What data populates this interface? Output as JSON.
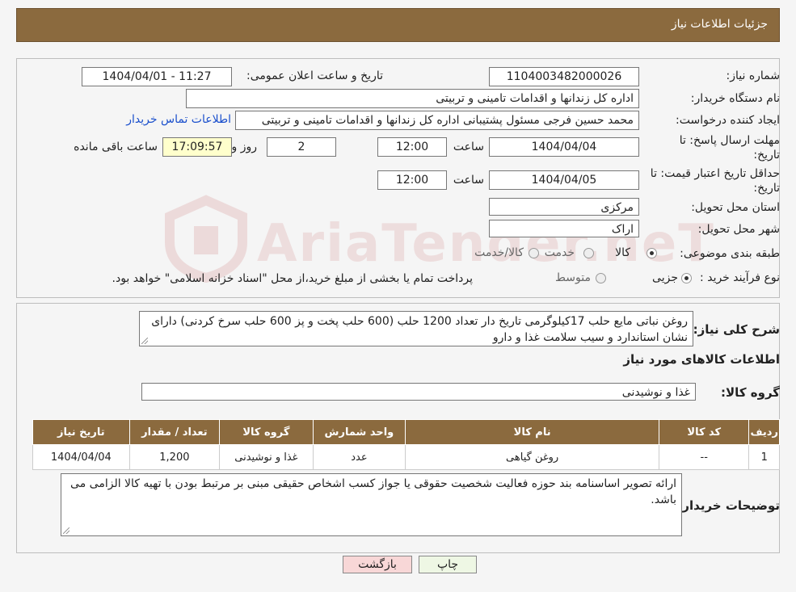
{
  "header": {
    "title": "جزئیات اطلاعات نیاز"
  },
  "form": {
    "need_number": {
      "label": "شماره نیاز:",
      "value": "1104003482000026"
    },
    "announce": {
      "label": "تاریخ و ساعت اعلان عمومی:",
      "value": "1404/04/01 - 11:27"
    },
    "buyer_org": {
      "label": "نام دستگاه خریدار:",
      "value": "اداره کل زندانها و اقدامات تامینی و تربیتی"
    },
    "requester": {
      "label": "ایجاد کننده درخواست:",
      "value": "محمد حسین فرجی مسئول پشتیبانی اداره کل زندانها و اقدامات تامینی و تربیتی",
      "contact_link": "اطلاعات تماس خریدار"
    },
    "deadline": {
      "label_line1": "مهلت ارسال پاسخ: تا",
      "label_line2": "تاریخ:",
      "date": "1404/04/04",
      "time_label": "ساعت",
      "time": "12:00",
      "days": "2",
      "days_label": "روز و",
      "remaining": "17:09:57",
      "remaining_label": "ساعت باقی مانده"
    },
    "price_validity": {
      "label_line1": "حداقل تاریخ اعتبار قیمت: تا",
      "label_line2": "تاریخ:",
      "date": "1404/04/05",
      "time_label": "ساعت",
      "time": "12:00"
    },
    "province": {
      "label": "استان محل تحویل:",
      "value": "مرکزی"
    },
    "city": {
      "label": "شهر محل تحویل:",
      "value": "اراک"
    },
    "category": {
      "label": "طبقه بندی موضوعی:",
      "options": [
        "کالا",
        "خدمت",
        "کالا/خدمت"
      ],
      "selected": "کالا"
    },
    "process": {
      "label": "نوع فرآیند خرید :",
      "options": [
        "جزیی",
        "متوسط"
      ],
      "selected": "جزیی",
      "note": "پرداخت تمام یا بخشی از مبلغ خرید،از محل \"اسناد خزانه اسلامی\" خواهد بود."
    }
  },
  "summary": {
    "label": "شرح کلی نیاز:",
    "text": "روغن نباتی مایع حلب 17کیلوگرمی تاریخ دار تعداد 1200 حلب (600 حلب پخت و پز 600 حلب سرخ کردنی) دارای نشان استاندارد و سیب سلامت غذا و دارو",
    "goods_title": "اطلاعات کالاهای مورد نیاز",
    "group_label": "گروه کالا:",
    "group_value": "غذا و نوشیدنی"
  },
  "table": {
    "columns": [
      "ردیف",
      "کد کالا",
      "نام کالا",
      "واحد شمارش",
      "گروه کالا",
      "تعداد / مقدار",
      "تاریخ نیاز"
    ],
    "rows": [
      [
        "1",
        "--",
        "روغن گیاهی",
        "عدد",
        "غذا و نوشیدنی",
        "1,200",
        "1404/04/04"
      ]
    ]
  },
  "buyer_notes": {
    "label": "توضیحات خریدار:",
    "text": "ارائه تصویر اساسنامه بند حوزه فعالیت شخصیت حقوقی یا جواز کسب اشخاص حقیقی مبنی بر مرتبط بودن با تهیه کالا الزامی می باشد."
  },
  "buttons": {
    "print": "چاپ",
    "back": "بازگشت"
  },
  "watermark": "AriaTender.neT",
  "colors": {
    "header": "#8b6a3e",
    "link": "#1a4fcc",
    "back_button": "#f8d7d7",
    "print_button": "#eef7e4",
    "remaining_bg": "#ffffcc"
  }
}
